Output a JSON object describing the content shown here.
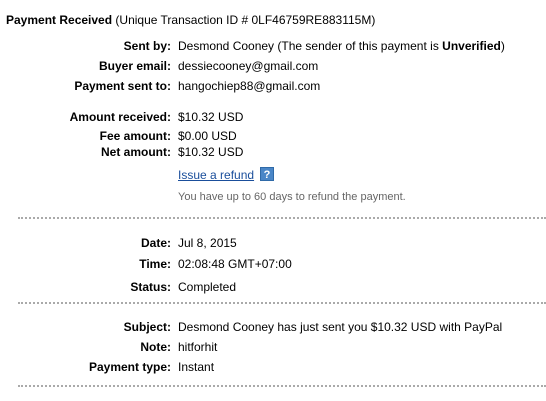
{
  "header": {
    "title": "Payment Received",
    "transaction_text": "(Unique Transaction ID # 0LF46759RE883115M)"
  },
  "sender": {
    "sent_by_label": "Sent by:",
    "sent_by_name": "Desmond Cooney",
    "sent_by_note_prefix": "(The sender of this payment is ",
    "sent_by_status": "Unverified",
    "sent_by_note_suffix": ")",
    "buyer_email_label": "Buyer email:",
    "buyer_email": "dessiecooney@gmail.com",
    "payment_sent_to_label": "Payment sent to:",
    "payment_sent_to": "hangochiep88@gmail.com"
  },
  "amounts": {
    "amount_received_label": "Amount received:",
    "amount_received": "$10.32 USD",
    "fee_amount_label": "Fee amount:",
    "fee_amount": "$0.00 USD",
    "net_amount_label": "Net amount:",
    "net_amount": "$10.32 USD"
  },
  "refund": {
    "link_label": "Issue a refund",
    "help_icon": "question-mark-icon",
    "help_glyph": "?",
    "note": "You have up to 60 days to refund the payment."
  },
  "details": {
    "date_label": "Date:",
    "date": "Jul 8, 2015",
    "time_label": "Time:",
    "time": "02:08:48 GMT+07:00",
    "status_label": "Status:",
    "status": "Completed"
  },
  "message": {
    "subject_label": "Subject:",
    "subject": "Desmond Cooney has just sent you $10.32 USD with PayPal",
    "note_label": "Note:",
    "note": "hitforhit",
    "payment_type_label": "Payment type:",
    "payment_type": "Instant"
  },
  "colors": {
    "link": "#1a4e9b",
    "help_icon_bg": "#4a86c7",
    "muted_text": "#666666",
    "divider": "#aaaaaa"
  }
}
